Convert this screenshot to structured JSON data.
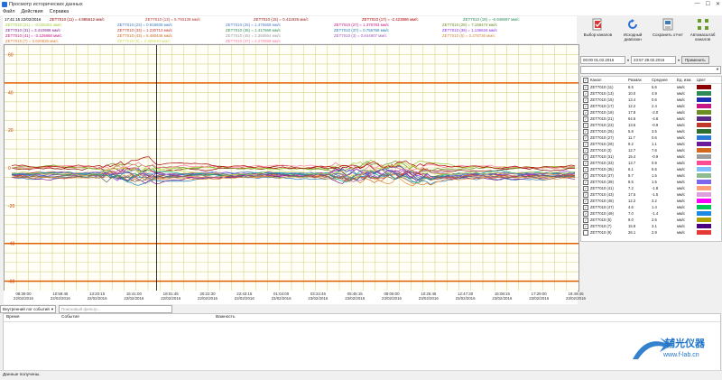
{
  "window": {
    "title": "Просмотр исторических данных"
  },
  "menu": [
    "Файл",
    "Действия",
    "Справка"
  ],
  "legend": {
    "timestamp": "17:41:15 22/02/2016",
    "entries": [
      {
        "text": "ZET7010 (11) = 4.885612 мм/с",
        "color": "#8b0000"
      },
      {
        "text": "ZET7010 (13) = 5.793139 мм/с",
        "color": "#b23a3a"
      },
      {
        "text": "ZET7010 (15) = 0.411926 мм/с",
        "color": "#9a2020"
      },
      {
        "text": "ZET7010 (17) = -2.423886 мм/с",
        "color": "#b00000"
      },
      {
        "text": "ZET7010 (19) = -6.948697 мм/с",
        "color": "#2e8b57"
      },
      {
        "text": "ZET7010 (21) = -0.025301 мм/с",
        "color": "#9acd32"
      },
      {
        "text": "ZET7010 (23) = 0.918939 мм/с",
        "color": "#3b7bbf"
      },
      {
        "text": "ZET7010 (25) = 1.475668 мм/с",
        "color": "#4a7bc8"
      },
      {
        "text": "ZET7010 (27) = 1.376783 мм/с",
        "color": "#c71585"
      },
      {
        "text": "ZET7010 (29) = 7.158474 мм/с",
        "color": "#6b8e23"
      },
      {
        "text": "ZET7010 (31) = 3.410988 мм/с",
        "color": "#7a1f8f"
      },
      {
        "text": "ZET7010 (33) = 1.230713 мм/с",
        "color": "#c0392b"
      },
      {
        "text": "ZET7010 (35) = 1.417668 мм/с",
        "color": "#2e8b57"
      },
      {
        "text": "ZET7010 (37) = 0.756768 мм/с",
        "color": "#1f77b4"
      },
      {
        "text": "ZET7010 (39) = 1.136634 мм/с",
        "color": "#8a2be2"
      },
      {
        "text": "ZET7010 (41) = -3.126868 мм/с",
        "color": "#c71585"
      },
      {
        "text": "ZET7010 (43) = 5.480446 мм/с",
        "color": "#d2691e"
      },
      {
        "text": "ZET7010 (45) = 2.355664 мм/с",
        "color": "#9a9a9a"
      },
      {
        "text": "ZET7010 (3) = 0.844907 мм/с",
        "color": "#9b59b6"
      },
      {
        "text": "ZET7010 (5) = 0.378736 мм/с",
        "color": "#cd853f"
      },
      {
        "text": "ZET7010 (7) = 2.620836 мм/с",
        "color": "#e08030"
      },
      {
        "text": "ZET7010 (9) = 2.386630 мм/с",
        "color": "#ccdd55"
      },
      {
        "text": "ZET7010 (47) = 2.270899 мм/с",
        "color": "#ff7799"
      }
    ]
  },
  "chart_data": {
    "type": "line",
    "ylim": [
      -65,
      65
    ],
    "y_ticks": [
      60,
      40,
      20,
      0,
      -20,
      -40,
      -60
    ],
    "thresholds": [
      45,
      -40,
      -60
    ],
    "x_ticks": [
      [
        "08:39:00",
        "22/02/2016"
      ],
      [
        "10:59:45",
        "22/02/2016"
      ],
      [
        "13:20:15",
        "22/02/2016"
      ],
      [
        "15:41:00",
        "22/02/2016"
      ],
      [
        "18:01:45",
        "22/02/2016"
      ],
      [
        "20:22:30",
        "22/02/2016"
      ],
      [
        "22:43:15",
        "22/02/2016"
      ],
      [
        "01:04:00",
        "23/02/2016"
      ],
      [
        "03:24:45",
        "23/02/2016"
      ],
      [
        "05:45:15",
        "23/02/2016"
      ],
      [
        "08:06:00",
        "23/02/2016"
      ],
      [
        "10:26:45",
        "23/02/2016"
      ],
      [
        "12:47:30",
        "23/02/2016"
      ],
      [
        "15:08:15",
        "23/02/2016"
      ],
      [
        "17:29:00",
        "23/02/2016"
      ],
      [
        "19:49:45",
        "23/02/2016"
      ]
    ],
    "cursor_time": "17:41:15 22/02/2016",
    "series_colors": [
      "#8b0000",
      "#2e8b57",
      "#1f77b4",
      "#c71585",
      "#6b8e23",
      "#d2691e",
      "#7a1f8f",
      "#c0392b",
      "#9acd32",
      "#8a2be2",
      "#e08030",
      "#3b7bbf",
      "#ff7799",
      "#4a7bc8",
      "#cd853f",
      "#9b59b6",
      "#b00000",
      "#00aa88",
      "#666666",
      "#ccdd55"
    ]
  },
  "event_log": {
    "type_value": "Внутренний лог событий",
    "filter_placeholder": "Поисковый фильтр...",
    "columns": [
      "Время",
      "Событие",
      "Важность"
    ]
  },
  "toolbar": {
    "buttons": [
      {
        "label": "Выбор каналов"
      },
      {
        "label": "Исходный диапазон"
      },
      {
        "label": "Сохранить отчет"
      },
      {
        "label": "Автомасштаб каналов"
      }
    ]
  },
  "range": {
    "from": "00:00 01.02.2016",
    "to": "23:57 29.02.2016",
    "apply": "Применить"
  },
  "channels": {
    "headers": [
      "Канал",
      "Размах",
      "Среднее",
      "Ед. изм.",
      "Цвет"
    ],
    "rows": [
      {
        "name": "ZET7010 (11)",
        "range": "6.5",
        "mean": "5.6",
        "unit": "мм/с",
        "color": "#8b0000",
        "checked": true
      },
      {
        "name": "ZET7010 (13)",
        "range": "10.0",
        "mean": "4.9",
        "unit": "мм/с",
        "color": "#2e8b57",
        "checked": true
      },
      {
        "name": "ZET7010 (15)",
        "range": "13.4",
        "mean": "0.6",
        "unit": "мм/с",
        "color": "#1f2fb4",
        "checked": true
      },
      {
        "name": "ZET7010 (17)",
        "range": "12.2",
        "mean": "2.4",
        "unit": "мм/с",
        "color": "#c71585",
        "checked": true
      },
      {
        "name": "ZET7010 (19)",
        "range": "17.8",
        "mean": "-2.0",
        "unit": "мм/с",
        "color": "#6b8e23",
        "checked": true
      },
      {
        "name": "ZET7010 (21)",
        "range": "64.6",
        "mean": "-4.8",
        "unit": "мм/с",
        "color": "#5b2a86",
        "checked": true
      },
      {
        "name": "ZET7010 (23)",
        "range": "13.5",
        "mean": "-0.9",
        "unit": "мм/с",
        "color": "#c0392b",
        "checked": true
      },
      {
        "name": "ZET7010 (25)",
        "range": "5.8",
        "mean": "3.5",
        "unit": "мм/с",
        "color": "#2e6e2e",
        "checked": true
      },
      {
        "name": "ZET7010 (27)",
        "range": "11.7",
        "mean": "0.6",
        "unit": "мм/с",
        "color": "#2a7bd6",
        "checked": true
      },
      {
        "name": "ZET7010 (29)",
        "range": "9.2",
        "mean": "1.1",
        "unit": "мм/с",
        "color": "#6a1b9a",
        "checked": true
      },
      {
        "name": "ZET7010 (3)",
        "range": "12.7",
        "mean": "7.6",
        "unit": "мм/с",
        "color": "#d2691e",
        "checked": true
      },
      {
        "name": "ZET7010 (31)",
        "range": "15.4",
        "mean": "-0.9",
        "unit": "мм/с",
        "color": "#9e9e9e",
        "checked": true
      },
      {
        "name": "ZET7010 (33)",
        "range": "13.7",
        "mean": "0.9",
        "unit": "мм/с",
        "color": "#ff4d94",
        "checked": true
      },
      {
        "name": "ZET7010 (35)",
        "range": "6.1",
        "mean": "5.6",
        "unit": "мм/с",
        "color": "#7fbfff",
        "checked": true
      },
      {
        "name": "ZET7010 (37)",
        "range": "9.7",
        "mean": "1.5",
        "unit": "мм/с",
        "color": "#8fbc8f",
        "checked": true
      },
      {
        "name": "ZET7010 (39)",
        "range": "8.5",
        "mean": "1.5",
        "unit": "мм/с",
        "color": "#7b68ee",
        "checked": true
      },
      {
        "name": "ZET7010 (41)",
        "range": "7.2",
        "mean": "-1.8",
        "unit": "мм/с",
        "color": "#ffa07a",
        "checked": true
      },
      {
        "name": "ZET7010 (43)",
        "range": "17.5",
        "mean": "-1.5",
        "unit": "мм/с",
        "color": "#dda0dd",
        "checked": true
      },
      {
        "name": "ZET7010 (45)",
        "range": "12.2",
        "mean": "3.2",
        "unit": "мм/с",
        "color": "#ff00ff",
        "checked": true
      },
      {
        "name": "ZET7010 (47)",
        "range": "4.6",
        "mean": "1.4",
        "unit": "мм/с",
        "color": "#00c853",
        "checked": true
      },
      {
        "name": "ZET7010 (49)",
        "range": "7.0",
        "mean": "-1.4",
        "unit": "мм/с",
        "color": "#1e88e5",
        "checked": true
      },
      {
        "name": "ZET7010 (5)",
        "range": "9.0",
        "mean": "2.6",
        "unit": "мм/с",
        "color": "#b0a000",
        "checked": true
      },
      {
        "name": "ZET7010 (7)",
        "range": "15.8",
        "mean": "3.1",
        "unit": "мм/с",
        "color": "#4b0082",
        "checked": true
      },
      {
        "name": "ZET7010 (9)",
        "range": "26.1",
        "mean": "2.9",
        "unit": "мм/с",
        "color": "#e53935",
        "checked": false
      }
    ]
  },
  "status": {
    "text": "Данные получены."
  },
  "watermark": {
    "text": "辅光仪器",
    "url": "www.f-lab.cn"
  }
}
